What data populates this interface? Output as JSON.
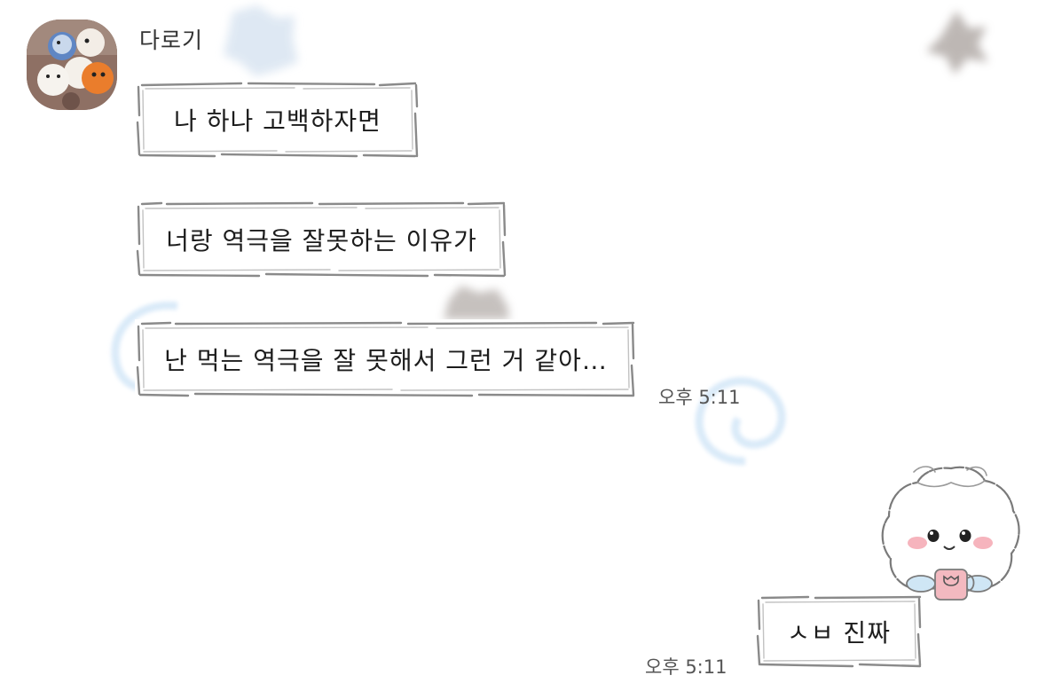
{
  "chat": {
    "sender_name": "다로기",
    "messages": [
      {
        "text": "나 하나 고백하자면"
      },
      {
        "text": "너랑 역극을 잘못하는 이유가"
      },
      {
        "text": "난 먹는 역극을 잘 못해서 그런 거 같아…",
        "time": "오후 5:11"
      }
    ],
    "reply": {
      "text": "ㅅㅂ 진짜",
      "time": "오후 5:11"
    }
  },
  "icons": {
    "avatar": "plush-dolls-photo-avatar",
    "sticker": "chiikawa-character-holding-mug-sticker"
  },
  "colors": {
    "bubble_border": "#8a8a8a",
    "bg_star": "#8c8480",
    "bg_swirl": "#d4e6f7",
    "text": "#1c1c1c",
    "time_text": "#555555"
  }
}
